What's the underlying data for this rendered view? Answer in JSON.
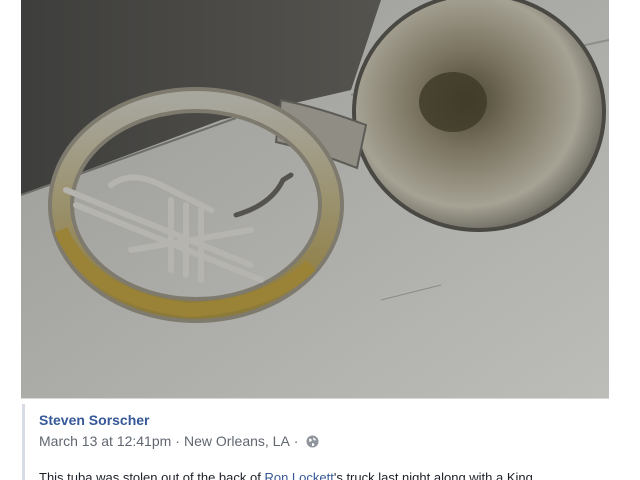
{
  "post": {
    "image_alt": "Photo of a brass sousaphone lying on pavement",
    "author_name": "Steven Sorscher",
    "timestamp": "March 13 at 12:41pm",
    "separator": "·",
    "location": "New Orleans, LA",
    "privacy_icon": "globe-icon",
    "text_before": "This tuba was stolen out of the back of ",
    "text_link": "Ron Lockett",
    "text_after": "'s truck last night along with a King"
  },
  "colors": {
    "link": "#365899",
    "meta_text": "#616770",
    "body_text": "#1d2129"
  }
}
